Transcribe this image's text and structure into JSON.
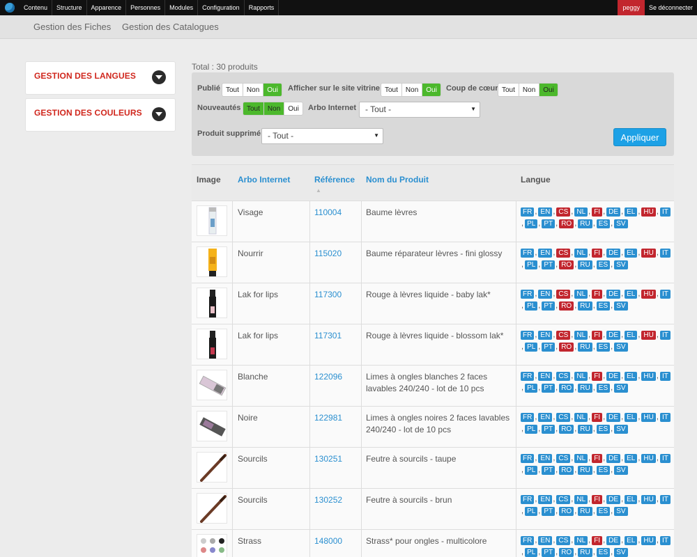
{
  "toolbar": {
    "menu": [
      "Contenu",
      "Structure",
      "Apparence",
      "Personnes",
      "Modules",
      "Configuration",
      "Rapports"
    ],
    "user": "peggy",
    "logout": "Se déconnecter"
  },
  "subnav": {
    "fiches": "Gestion des Fiches",
    "catalogues": "Gestion des Catalogues"
  },
  "sidebar": [
    {
      "title": "GESTION DES LANGUES"
    },
    {
      "title": "GESTION DES COULEURS"
    }
  ],
  "total": "Total : 30 produits",
  "filters": {
    "publie_label": "Publié",
    "vitrine_label": "Afficher sur le site vitrine",
    "coup_label": "Coup de cœur",
    "nouveautes_label": "Nouveautés",
    "arbo_label": "Arbo Internet",
    "supprime_label": "Produit supprimé",
    "seg_tout": "Tout",
    "seg_non": "Non",
    "seg_oui": "Oui",
    "arbo_value": "- Tout -",
    "supprime_value": "- Tout -",
    "apply": "Appliquer",
    "colors": {
      "active": "#4cb82c",
      "apply": "#1da1e6"
    }
  },
  "table": {
    "headers": {
      "image": "Image",
      "arbo": "Arbo Internet",
      "reference": "Référence",
      "nom": "Nom du Produit",
      "langue": "Langue"
    },
    "rows": [
      {
        "arbo": "Visage",
        "ref": "110004",
        "nom": "Baume lèvres",
        "red": [
          "CS",
          "FI",
          "HU",
          "RO"
        ],
        "thumb": "tube-white"
      },
      {
        "arbo": "Nourrir",
        "ref": "115020",
        "nom": "Baume réparateur lèvres - fini glossy",
        "red": [
          "CS",
          "FI",
          "HU",
          "RO"
        ],
        "thumb": "tube-yellow"
      },
      {
        "arbo": "Lak for lips",
        "ref": "117300",
        "nom": "Rouge à lèvres liquide - baby lak*",
        "red": [
          "CS",
          "FI",
          "HU",
          "RO"
        ],
        "thumb": "lipgloss"
      },
      {
        "arbo": "Lak for lips",
        "ref": "117301",
        "nom": "Rouge à lèvres liquide - blossom lak*",
        "red": [
          "CS",
          "FI",
          "HU",
          "RO"
        ],
        "thumb": "lipgloss2"
      },
      {
        "arbo": "Blanche",
        "ref": "122096",
        "nom": "Limes à ongles blanches 2 faces lavables 240/240 - lot de 10 pcs",
        "red": [
          "FI"
        ],
        "thumb": "file-white"
      },
      {
        "arbo": "Noire",
        "ref": "122981",
        "nom": "Limes à ongles noires 2 faces lavables 240/240 - lot de 10 pcs",
        "red": [
          "FI"
        ],
        "thumb": "file-black"
      },
      {
        "arbo": "Sourcils",
        "ref": "130251",
        "nom": "Feutre à sourcils - taupe",
        "red": [
          "FI"
        ],
        "thumb": "pen"
      },
      {
        "arbo": "Sourcils",
        "ref": "130252",
        "nom": "Feutre à sourcils - brun",
        "red": [
          "FI"
        ],
        "thumb": "pen"
      },
      {
        "arbo": "Strass",
        "ref": "148000",
        "nom": "Strass* pour ongles - multicolore",
        "red": [
          "FI"
        ],
        "thumb": "strass"
      }
    ],
    "languages": [
      "FR",
      "EN",
      "CS",
      "NL",
      "FI",
      "DE",
      "EL",
      "HU",
      "IT",
      "PL",
      "PT",
      "RO",
      "RU",
      "ES",
      "SV"
    ],
    "colors": {
      "blue": "#2a8fd0",
      "red": "#c2262e"
    }
  }
}
